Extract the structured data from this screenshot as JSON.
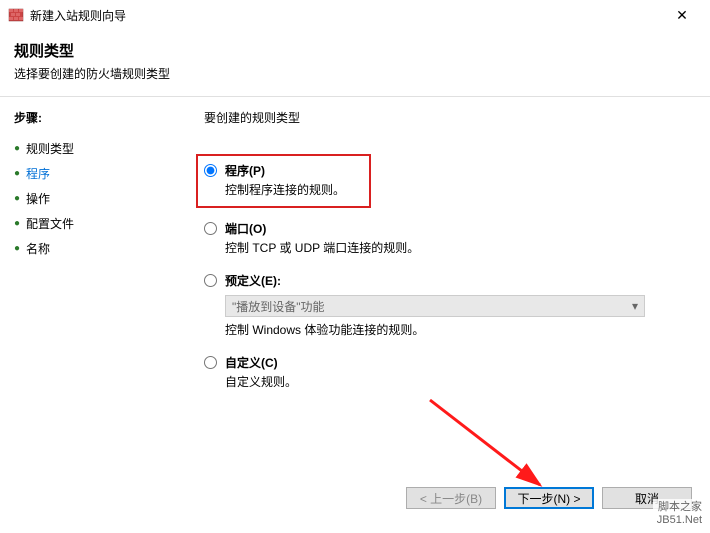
{
  "titlebar": {
    "title": "新建入站规则向导",
    "close": "✕"
  },
  "header": {
    "title": "规则类型",
    "subtitle": "选择要创建的防火墙规则类型"
  },
  "sidebar": {
    "title": "步骤:",
    "items": [
      {
        "label": "规则类型"
      },
      {
        "label": "程序"
      },
      {
        "label": "操作"
      },
      {
        "label": "配置文件"
      },
      {
        "label": "名称"
      }
    ]
  },
  "main": {
    "title": "要创建的规则类型",
    "options": {
      "program": {
        "label": "程序(P)",
        "desc": "控制程序连接的规则。"
      },
      "port": {
        "label": "端口(O)",
        "desc": "控制 TCP 或 UDP 端口连接的规则。"
      },
      "predefined": {
        "label": "预定义(E):",
        "select": "\"播放到设备\"功能",
        "desc": "控制 Windows 体验功能连接的规则。"
      },
      "custom": {
        "label": "自定义(C)",
        "desc": "自定义规则。"
      }
    }
  },
  "footer": {
    "back": "< 上一步(B)",
    "next": "下一步(N) >",
    "cancel": "取消"
  },
  "watermark": {
    "line1": "脚本之家",
    "line2": "JB51.Net"
  }
}
